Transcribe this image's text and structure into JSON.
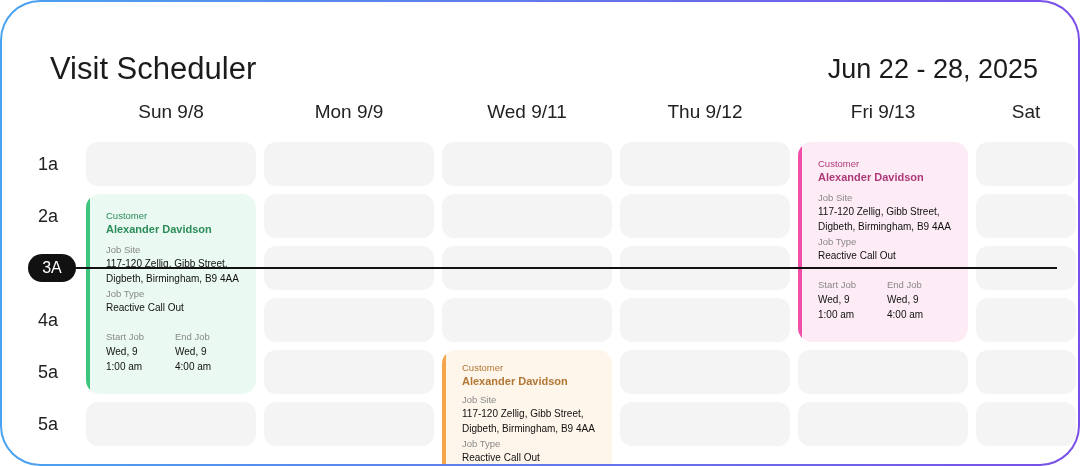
{
  "title": "Visit Scheduler",
  "date_range": "Jun 22 - 28, 2025",
  "times": [
    {
      "label": "1a",
      "current": false
    },
    {
      "label": "2a",
      "current": false
    },
    {
      "label": "3A",
      "current": true
    },
    {
      "label": "4a",
      "current": false
    },
    {
      "label": "5a",
      "current": false
    },
    {
      "label": "5a",
      "current": false
    }
  ],
  "days": [
    {
      "label": "Sun 9/8",
      "cells": [
        {
          "kind": "slot"
        },
        {
          "kind": "visit",
          "color": "#3cc47c",
          "customer_label": "Customer",
          "customer": "Alexander Davidson",
          "fields": [
            {
              "label": "Job Site",
              "value": "117-120 Zellig, Gibb Street, Digbeth, Birmingham, B9 4AA"
            },
            {
              "label": "Job Type",
              "value": "Reactive Call Out"
            }
          ],
          "times": [
            {
              "label": "Start Job",
              "lines": [
                "Wed, 9",
                "1:00 am"
              ]
            },
            {
              "label": "End Job",
              "lines": [
                "Wed, 9",
                "4:00 am"
              ]
            }
          ]
        },
        {
          "kind": "slot"
        }
      ]
    },
    {
      "label": "Mon 9/9",
      "cells": [
        {
          "kind": "slot"
        },
        {
          "kind": "slot"
        },
        {
          "kind": "slot"
        },
        {
          "kind": "slot"
        },
        {
          "kind": "slot"
        },
        {
          "kind": "slot"
        }
      ]
    },
    {
      "label": "Wed 9/11",
      "cells": [
        {
          "kind": "slot"
        },
        {
          "kind": "slot"
        },
        {
          "kind": "slot"
        },
        {
          "kind": "slot"
        },
        {
          "kind": "visit",
          "color": "#f5a54a",
          "customer_label": "Customer",
          "customer": "Alexander Davidson",
          "fields": [
            {
              "label": "Job Site",
              "value": "117-120 Zellig, Gibb Street, Digbeth, Birmingham, B9 4AA"
            },
            {
              "label": "Job Type",
              "value": "Reactive Call Out"
            }
          ]
        }
      ]
    },
    {
      "label": "Thu 9/12",
      "cells": [
        {
          "kind": "slot"
        },
        {
          "kind": "slot"
        },
        {
          "kind": "slot"
        },
        {
          "kind": "slot"
        },
        {
          "kind": "slot"
        },
        {
          "kind": "slot"
        }
      ]
    },
    {
      "label": "Fri 9/13",
      "cells": [
        {
          "kind": "visit",
          "color": "#f04fa8",
          "customer_label": "Customer",
          "customer": "Alexander Davidson",
          "fields": [
            {
              "label": "Job Site",
              "value": "117-120 Zellig, Gibb Street, Digbeth, Birmingham, B9 4AA"
            },
            {
              "label": "Job Type",
              "value": "Reactive Call Out"
            }
          ],
          "times": [
            {
              "label": "Start Job",
              "lines": [
                "Wed, 9",
                "1:00 am"
              ]
            },
            {
              "label": "End Job",
              "lines": [
                "Wed, 9",
                "4:00 am"
              ]
            }
          ]
        },
        {
          "kind": "slot"
        },
        {
          "kind": "slot"
        }
      ]
    },
    {
      "label": "Sat",
      "cells": [
        {
          "kind": "slot"
        },
        {
          "kind": "slot"
        },
        {
          "kind": "slot"
        },
        {
          "kind": "slot"
        },
        {
          "kind": "slot"
        },
        {
          "kind": "slot"
        }
      ]
    }
  ]
}
